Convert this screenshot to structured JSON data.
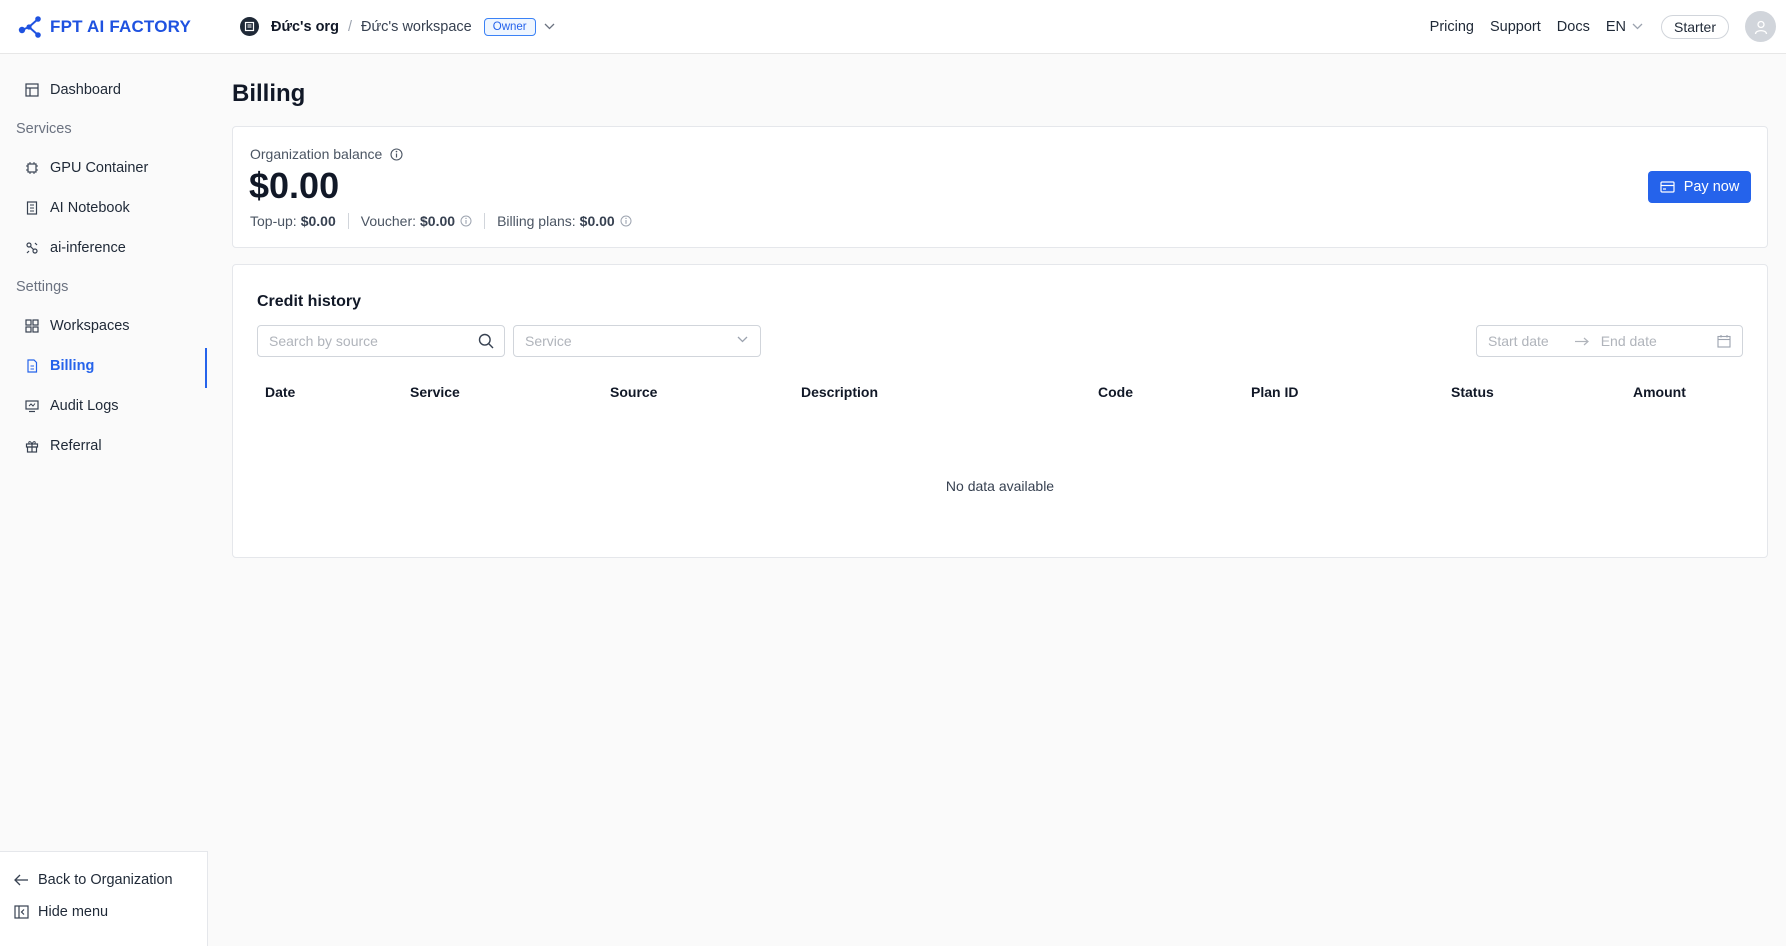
{
  "header": {
    "brand": "FPT AI FACTORY",
    "org_name": "Đức's org",
    "separator": "/",
    "workspace_name": "Đức's workspace",
    "role_badge": "Owner",
    "nav": [
      "Pricing",
      "Support",
      "Docs"
    ],
    "language": "EN",
    "plan": "Starter"
  },
  "sidebar": {
    "dashboard": "Dashboard",
    "services_heading": "Services",
    "services": [
      "GPU Container",
      "AI Notebook",
      "ai-inference"
    ],
    "settings_heading": "Settings",
    "settings": [
      "Workspaces",
      "Billing",
      "Audit Logs",
      "Referral"
    ],
    "back_label": "Back to Organization",
    "hide_label": "Hide menu"
  },
  "page": {
    "title": "Billing"
  },
  "balance": {
    "label": "Organization balance",
    "amount": "$0.00",
    "topup_label": "Top-up:",
    "topup_value": "$0.00",
    "voucher_label": "Voucher:",
    "voucher_value": "$0.00",
    "plans_label": "Billing plans:",
    "plans_value": "$0.00",
    "pay_button": "Pay now"
  },
  "credit_history": {
    "title": "Credit history",
    "search_placeholder": "Search by source",
    "service_placeholder": "Service",
    "start_date_placeholder": "Start date",
    "end_date_placeholder": "End date",
    "columns": [
      "Date",
      "Service",
      "Source",
      "Description",
      "Code",
      "Plan ID",
      "Status",
      "Amount"
    ],
    "empty_text": "No data available"
  },
  "colors": {
    "accent": "#2563eb",
    "brand": "#1f52e0"
  }
}
